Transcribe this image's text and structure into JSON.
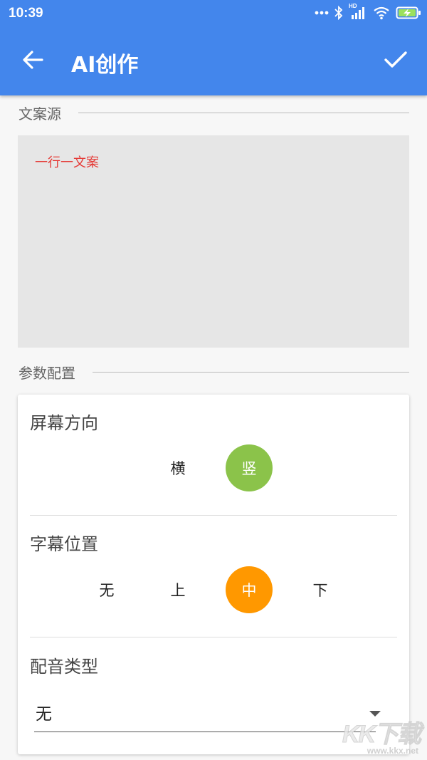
{
  "status_bar": {
    "time": "10:39",
    "icons": [
      "more-dots-icon",
      "bluetooth-icon",
      "hd-signal-icon",
      "wifi-icon",
      "battery-charging-icon"
    ],
    "hd_label": "HD"
  },
  "app_bar": {
    "title": "AI创作",
    "back_icon": "arrow-left-icon",
    "confirm_icon": "check-icon",
    "color": "#4386ec"
  },
  "source_section": {
    "header": "文案源",
    "placeholder": "一行一文案",
    "value": ""
  },
  "params_section": {
    "header": "参数配置",
    "orientation": {
      "label": "屏幕方向",
      "options": [
        "横",
        "竖"
      ],
      "selected": "竖",
      "selected_color": "#8bc34a"
    },
    "subtitle_position": {
      "label": "字幕位置",
      "options": [
        "无",
        "上",
        "中",
        "下"
      ],
      "selected": "中",
      "selected_color": "#ff9800"
    },
    "voice_type": {
      "label": "配音类型",
      "selected": "无",
      "arrow_icon": "dropdown-arrow-icon"
    }
  },
  "watermark": {
    "text": "KK下载",
    "url": "www.kkx.net"
  }
}
